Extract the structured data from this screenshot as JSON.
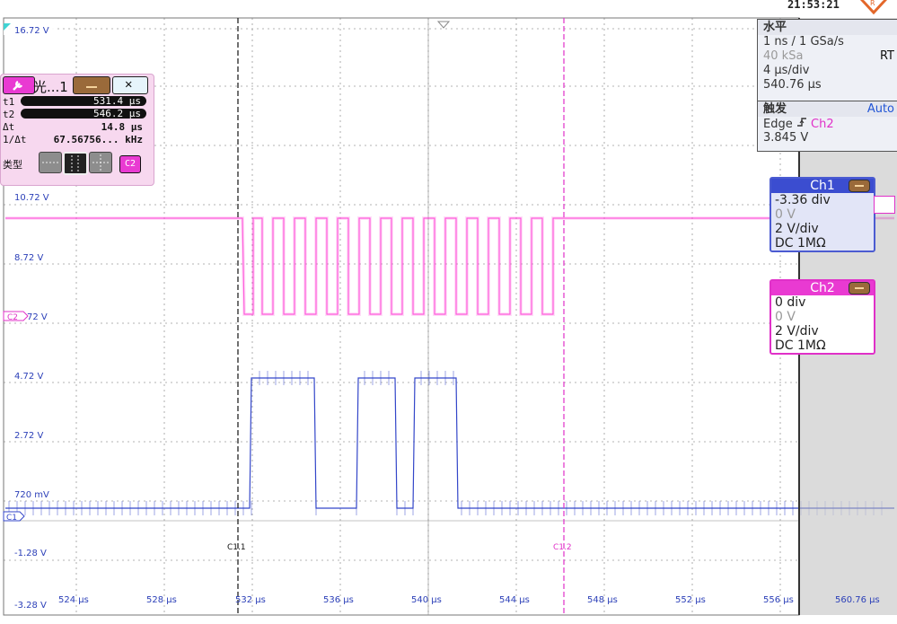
{
  "status": {
    "time": "21:53:21"
  },
  "scope": {
    "y_labels": [
      "16.72 V",
      "10.72 V",
      "8.72 V",
      "4.72 V",
      "2.72 V",
      "720 mV",
      "-1.28 V",
      "-3.28 V",
      "72 V"
    ],
    "x_labels": [
      "524 µs",
      "528 µs",
      "532 µs",
      "536 µs",
      "540 µs",
      "544 µs",
      "548 µs",
      "552 µs",
      "556 µs",
      "560.76 µs"
    ],
    "markers": {
      "c1": "C1",
      "c2": "C2",
      "cursor1": "C1.1",
      "cursor2": "C1.2"
    },
    "colors": {
      "ch1": "#3346c9",
      "ch2": "#ff4bd8",
      "cursor1": "#111111",
      "cursor2": "#e030c8",
      "grid": "#9a9a9a"
    }
  },
  "horizontal": {
    "title": "水平",
    "resolution": "1 ns / 1 GSa/s",
    "record": "40 kSa",
    "mode": "RT",
    "time_div": "4 µs/div",
    "position": "540.76 µs"
  },
  "trigger": {
    "title": "触发",
    "mode": "Auto",
    "type": "Edge",
    "source": "Ch2",
    "level": "3.845 V"
  },
  "ch1": {
    "title": "Ch1",
    "offset": "-3.36 div",
    "offset_v": "0 V",
    "scale": "2 V/div",
    "coupling": "DC 1MΩ"
  },
  "ch2": {
    "title": "Ch2",
    "offset": "0 div",
    "offset_v": "0 V",
    "scale": "2 V/div",
    "coupling": "DC 1MΩ"
  },
  "cursor_dialog": {
    "title": "光...1",
    "t1_label": "t1",
    "t1": "531.4 µs",
    "t2_label": "t2",
    "t2": "546.2 µs",
    "dt_label": "Δt",
    "dt": "14.8 µs",
    "freq_label": "1/Δt",
    "freq": "67.56756... kHz",
    "type_label": "类型",
    "source": "C2"
  }
}
